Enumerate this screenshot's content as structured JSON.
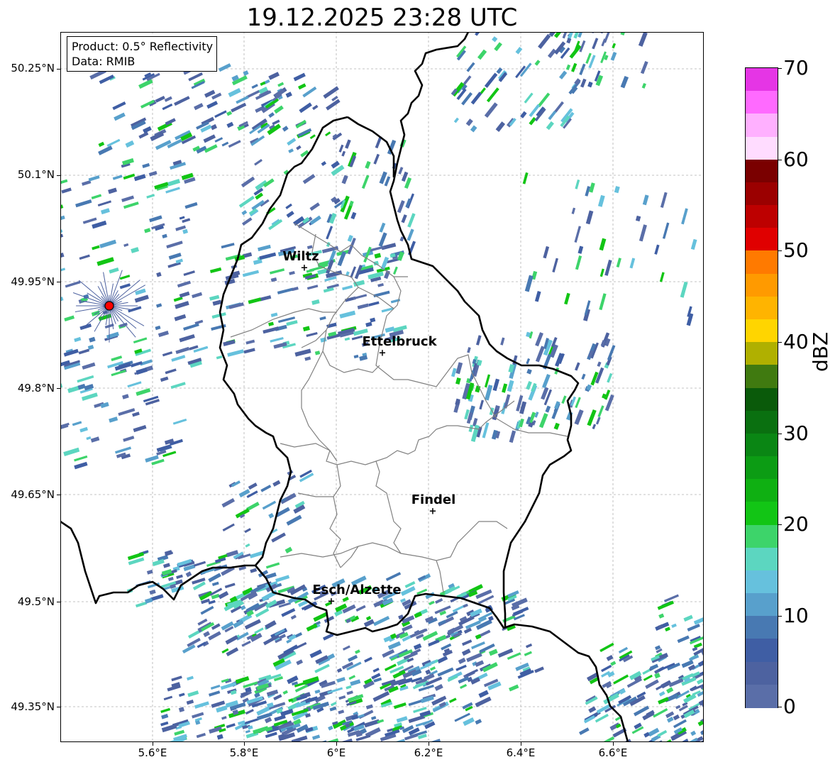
{
  "title": "19.12.2025 23:28 UTC",
  "info": {
    "product": "Product: 0.5° Reflectivity",
    "data": "Data: RMIB"
  },
  "lat_labels": [
    "50.25°N",
    "50.1°N",
    "49.95°N",
    "49.8°N",
    "49.65°N",
    "49.5°N",
    "49.35°N"
  ],
  "lon_labels": [
    "5.6°E",
    "5.8°E",
    "6°E",
    "6.2°E",
    "6.4°E",
    "6.6°E"
  ],
  "cities": [
    {
      "name": "Wiltz"
    },
    {
      "name": "Ettelbruck"
    },
    {
      "name": "Findel"
    },
    {
      "name": "Esch/Alzette"
    }
  ],
  "colorbar": {
    "label": "dBZ",
    "ticks": [
      "70",
      "60",
      "50",
      "40",
      "30",
      "20",
      "10",
      "0"
    ],
    "colors": [
      "#e535e5",
      "#ff6aff",
      "#ffb0ff",
      "#ffdcff",
      "#7a0000",
      "#9b0000",
      "#bd0000",
      "#e00000",
      "#ff7a00",
      "#ff9a00",
      "#ffb400",
      "#ffd500",
      "#b0b000",
      "#407a10",
      "#0a5a0a",
      "#0a7010",
      "#0a8614",
      "#0c9c14",
      "#0fb012",
      "#12c515",
      "#3dd46a",
      "#5cd6c0",
      "#66c1dd",
      "#58a0cc",
      "#4879b2",
      "#3f5ea4",
      "#4d62a0",
      "#5a6ea8"
    ]
  },
  "radar_site_color": "#ff0000"
}
